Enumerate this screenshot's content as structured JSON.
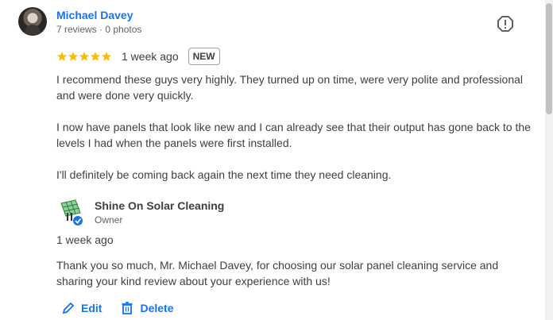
{
  "review": {
    "reviewer_name": "Michael Davey",
    "reviewer_meta": "7 reviews · 0 photos",
    "stars_count": 5,
    "time": "1 week ago",
    "badge": "NEW",
    "paragraphs": [
      "I recommend these guys very highly. They turned up on time, were very polite and professional and were done very quickly.",
      "I now have panels that look like new and I can already see that their output has gone back to the levels I had when the panels were first installed.",
      "I'll definitely be coming back again the next time they need cleaning."
    ]
  },
  "owner_reply": {
    "name": "Shine On Solar Cleaning",
    "role": "Owner",
    "time": "1 week ago",
    "text": "Thank you so much, Mr. Michael Davey, for choosing our solar panel cleaning service and sharing your kind review about your experience with us!"
  },
  "actions": {
    "edit_label": "Edit",
    "delete_label": "Delete"
  },
  "colors": {
    "accent": "#1a73e8",
    "star": "#fbbc04",
    "verified": "#1a73e8"
  },
  "icons": {
    "report": "report-icon",
    "edit": "pencil-icon",
    "delete": "trash-icon"
  }
}
